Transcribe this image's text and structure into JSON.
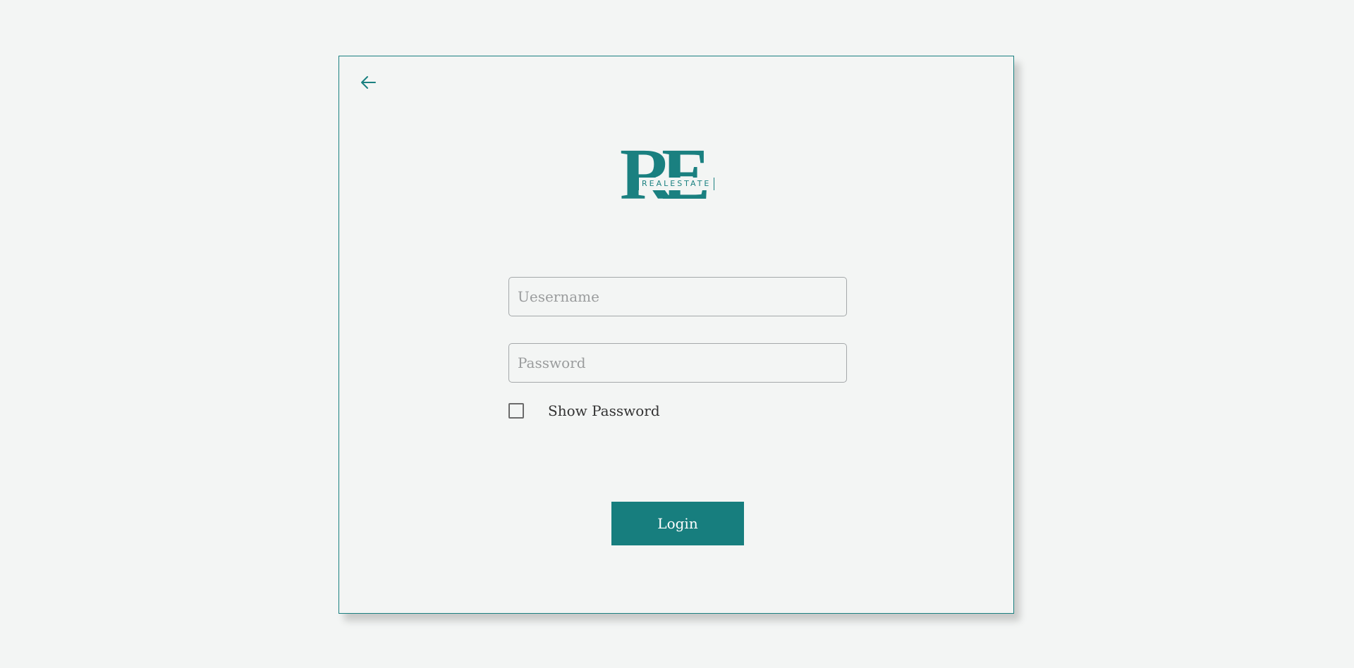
{
  "logo": {
    "letters": "RE",
    "tagline": "REALESTATE"
  },
  "form": {
    "username_placeholder": "Uesername",
    "username_value": "",
    "password_placeholder": "Password",
    "password_value": "",
    "show_password_label": "Show Password",
    "show_password_checked": false,
    "login_label": "Login"
  },
  "icons": {
    "back": "arrow-left-icon"
  },
  "colors": {
    "accent": "#177e7e",
    "border": "#1a8080",
    "background": "#f3f5f4",
    "input_border": "#a4a8aa"
  }
}
